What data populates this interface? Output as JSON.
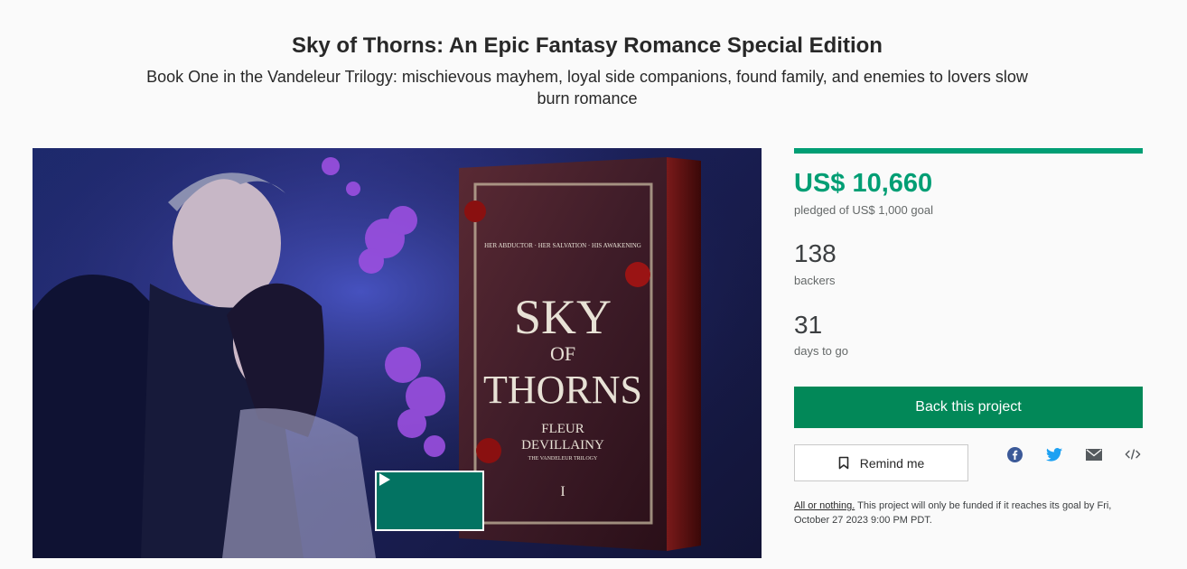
{
  "project": {
    "title": "Sky of Thorns: An Epic Fantasy Romance Special Edition",
    "subtitle": "Book One in the Vandeleur Trilogy: mischievous mayhem, loyal side companions, found family, and enemies to lovers slow burn romance"
  },
  "media": {
    "book_tagline": "HER ABDUCTOR · HER SALVATION · HIS AWAKENING",
    "book_title_line1": "SKY",
    "book_title_line2": "OF",
    "book_title_line3": "THORNS",
    "book_author_line1": "FLEUR",
    "book_author_line2": "DEVILLAINY",
    "book_series": "THE VANDELEUR TRILOGY",
    "book_number": "I",
    "play_icon": "play-icon"
  },
  "stats": {
    "funded_fraction": 1.0,
    "pledged": "US$ 10,660",
    "pledged_label": "pledged of US$ 1,000 goal",
    "backers": "138",
    "backers_label": "backers",
    "days": "31",
    "days_label": "days to go"
  },
  "actions": {
    "back_label": "Back this project",
    "remind_label": "Remind me",
    "share_icons": [
      "facebook-icon",
      "twitter-icon",
      "email-icon",
      "embed-icon"
    ]
  },
  "notice": {
    "link_text": "All or nothing.",
    "text": " This project will only be funded if it reaches its goal by Fri, October 27 2023 9:00 PM PDT."
  },
  "colors": {
    "accent": "#009e74",
    "back_button": "#028858",
    "play_button": "#037362",
    "facebook": "#1877f2",
    "twitter": "#1da1f2"
  }
}
